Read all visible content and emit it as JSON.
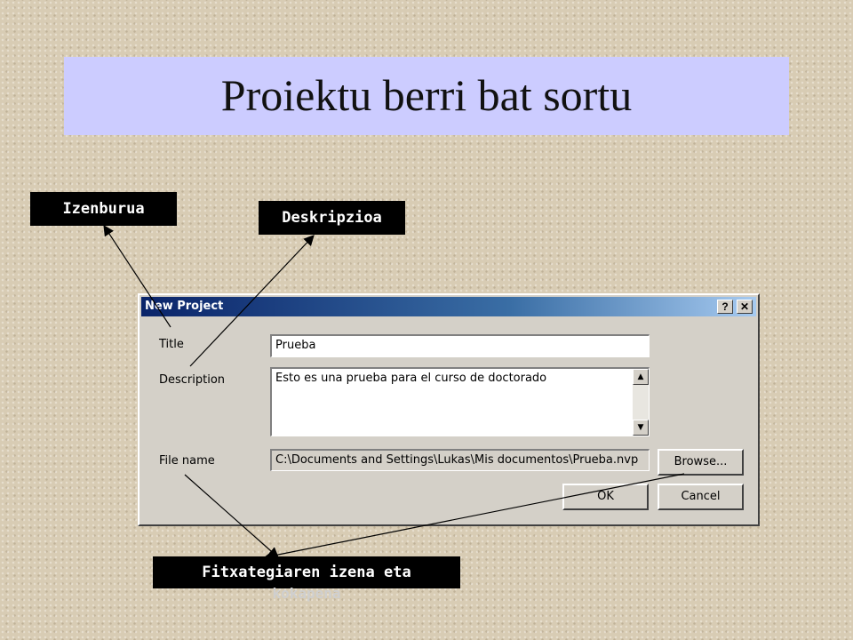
{
  "slide": {
    "title": "Proiektu berri bat sortu"
  },
  "callouts": {
    "title": "Izenburua",
    "description": "Deskripzioa",
    "file": "Fitxategiaren izena eta",
    "file_continued": "kokapena"
  },
  "dialog": {
    "window_title": "New Project",
    "help_label": "?",
    "close_label": "✕",
    "title_label": "Title",
    "title_value": "Prueba",
    "description_label": "Description",
    "description_value": "Esto es una prueba para el curso de doctorado",
    "file_label": "File name",
    "file_value": "C:\\Documents and Settings\\Lukas\\Mis documentos\\Prueba.nvp",
    "browse_label": "Browse...",
    "ok_label": "OK",
    "cancel_label": "Cancel"
  },
  "icons": {
    "scroll_up": "scroll-up-arrow-icon",
    "scroll_down": "scroll-down-arrow-icon"
  },
  "colors": {
    "title_band": "#ccccff",
    "titlebar_start": "#0a246a",
    "callout_bg": "#000000"
  }
}
